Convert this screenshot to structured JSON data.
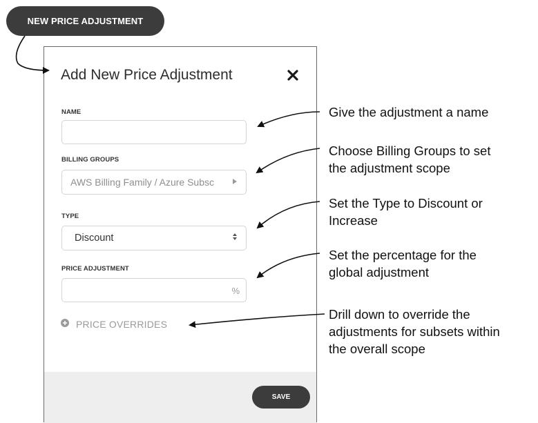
{
  "top_button": {
    "label": "NEW PRICE ADJUSTMENT"
  },
  "dialog": {
    "title": "Add New Price Adjustment",
    "close_icon": "close-icon",
    "fields": {
      "name": {
        "label": "NAME",
        "value": ""
      },
      "billing_groups": {
        "label": "BILLING GROUPS",
        "value": "AWS Billing Family / Azure Subsc"
      },
      "type": {
        "label": "TYPE",
        "value": "Discount"
      },
      "price_adjustment": {
        "label": "PRICE ADJUSTMENT",
        "value": "",
        "suffix": "%"
      }
    },
    "overrides": {
      "label": "PRICE OVERRIDES",
      "icon": "plus-circle-icon"
    },
    "save_label": "SAVE"
  },
  "callouts": {
    "name": "Give the adjustment a name",
    "billing_line1": "Choose Billing Groups to set",
    "billing_line2": "the adjustment scope",
    "type_line1": "Set the Type to Discount or",
    "type_line2": "Increase",
    "pct_line1": "Set the percentage for the",
    "pct_line2": "global adjustment",
    "drill_line1": "Drill down to override the",
    "drill_line2": "adjustments for subsets within",
    "drill_line3": "the overall scope"
  },
  "colors": {
    "button_dark": "#3c3c3c",
    "footer_bg": "#eeeeee",
    "border": "#d4d4d4"
  }
}
